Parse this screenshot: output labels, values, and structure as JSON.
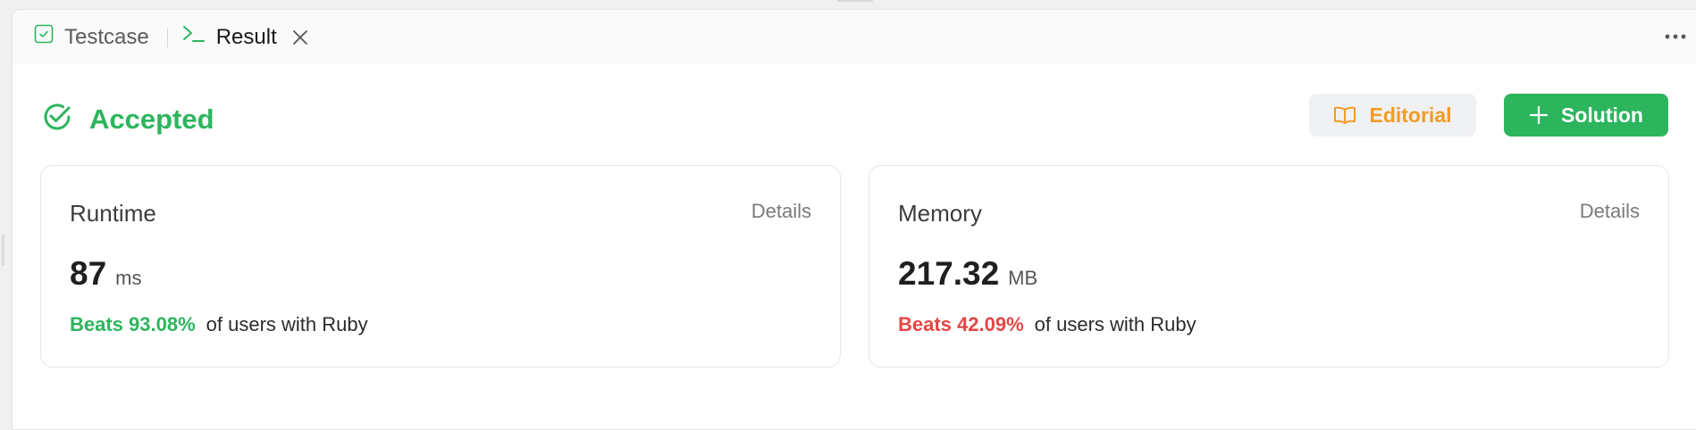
{
  "tabs": {
    "testcase_label": "Testcase",
    "result_label": "Result"
  },
  "status": {
    "label": "Accepted",
    "color": "#2db55d"
  },
  "actions": {
    "editorial_label": "Editorial",
    "solution_label": "Solution"
  },
  "runtime": {
    "title": "Runtime",
    "details_label": "Details",
    "value": "87",
    "unit": "ms",
    "beats": "Beats 93.08%",
    "beats_suffix": "of users with Ruby"
  },
  "memory": {
    "title": "Memory",
    "details_label": "Details",
    "value": "217.32",
    "unit": "MB",
    "beats": "Beats 42.09%",
    "beats_suffix": "of users with Ruby"
  },
  "icons": {
    "testcase": "checkbox-icon",
    "result": "terminal-icon",
    "close": "close-icon",
    "more": "more-horizontal-icon",
    "status": "check-circle-icon",
    "editorial": "book-open-icon",
    "solution": "plus-icon"
  },
  "colors": {
    "accent_green": "#2db55d",
    "editorial_orange": "#f29b26",
    "beats_red": "#e54545"
  }
}
